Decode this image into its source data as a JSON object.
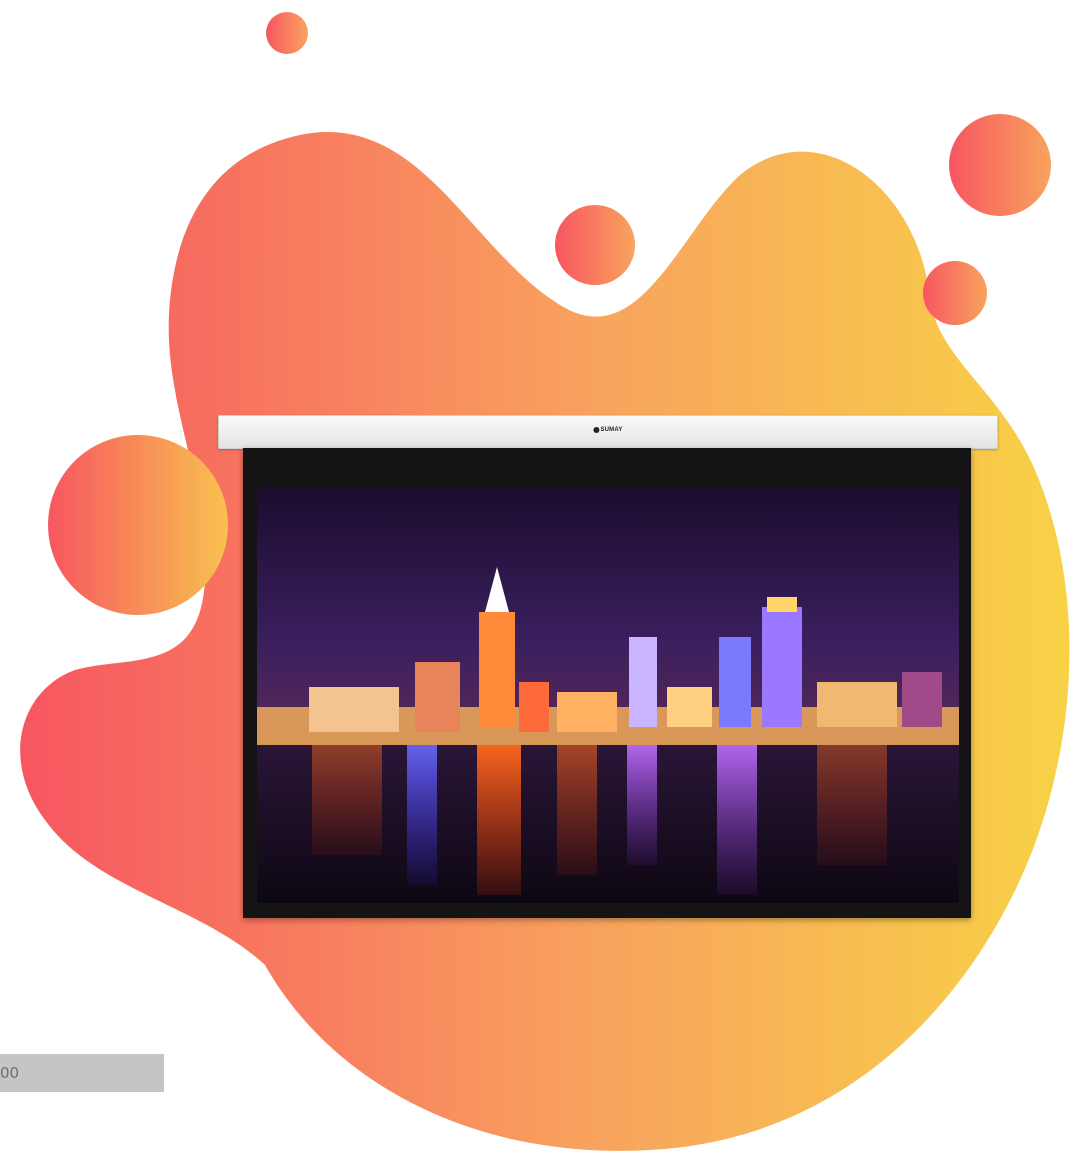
{
  "product": {
    "brand": "SUMAY",
    "image_subject": "projector-screen-night-city-skyline"
  },
  "field": {
    "visible_text": "00"
  },
  "colors": {
    "gradient_start": "#f75660",
    "gradient_mid": "#f8a35e",
    "gradient_end": "#f8d246",
    "screen_case": "#ececec",
    "screen_frame": "#141414",
    "field_bg": "#c4c5c7"
  }
}
